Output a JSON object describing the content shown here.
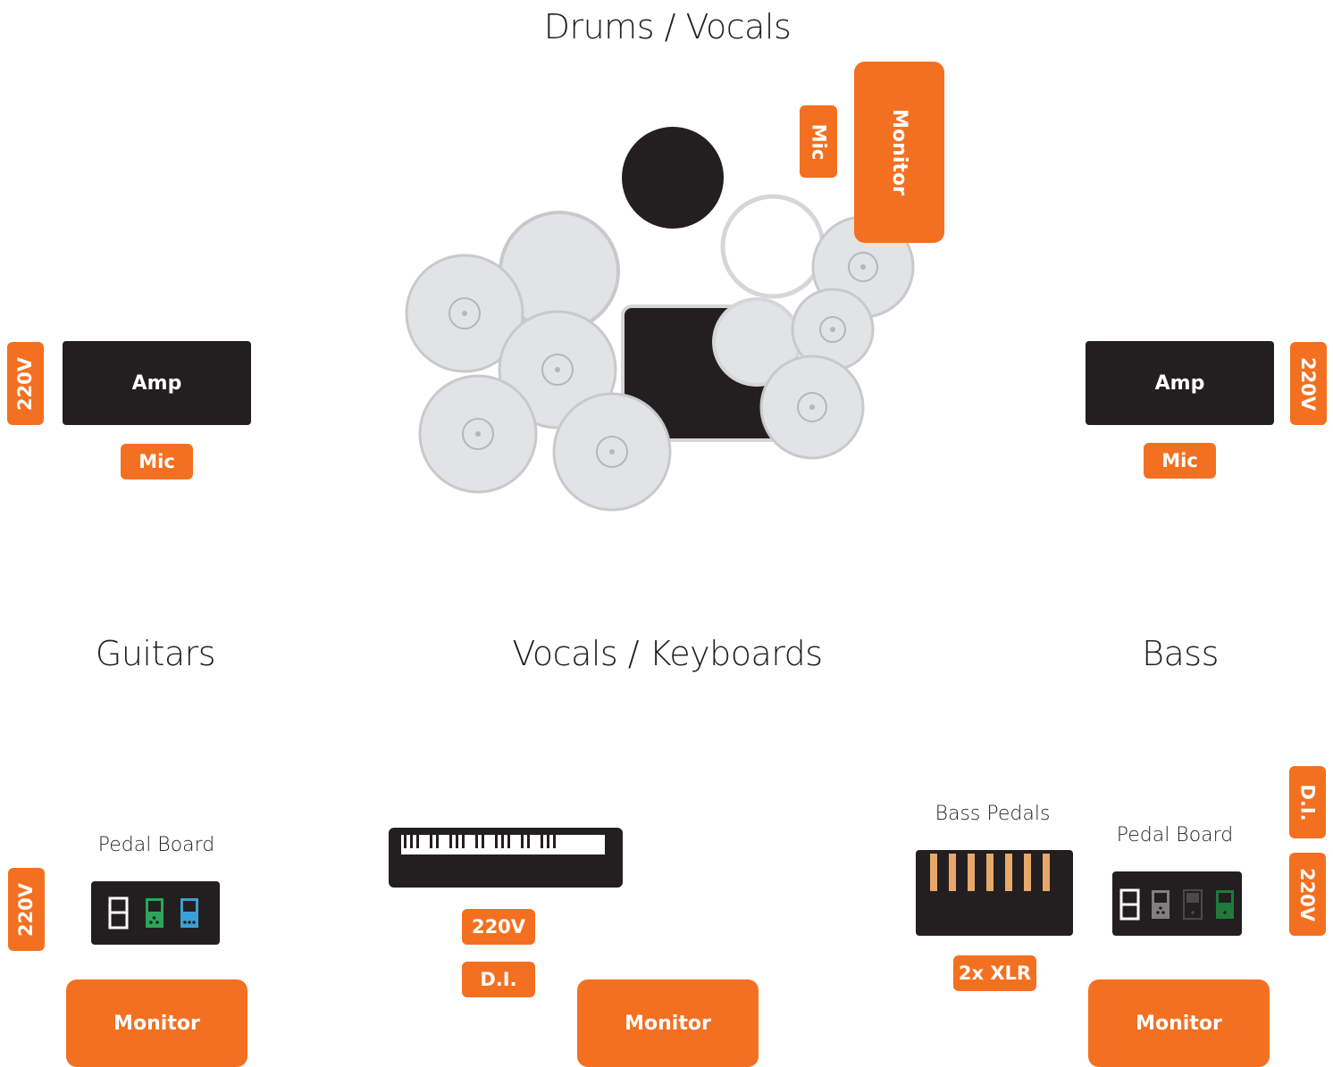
{
  "sections": {
    "drums_vocals": "Drums / Vocals",
    "guitars": "Guitars",
    "vocals_keyboards": "Vocals / Keyboards",
    "bass": "Bass"
  },
  "labels": {
    "monitor": "Monitor",
    "mic": "Mic",
    "amp": "Amp",
    "power": "220V",
    "di": "D.I.",
    "xlr": "2x XLR",
    "pedal_board": "Pedal Board",
    "bass_pedals": "Bass Pedals"
  },
  "colors": {
    "accent": "#f37021",
    "equipment": "#231f20",
    "cymbal": "#e2e3e5",
    "cymbal_edge": "#c8c9cb",
    "pedal_green": "#2ea55c",
    "pedal_blue": "#3d9fd8",
    "pedal_grey": "#808080",
    "pedal_darkgreen": "#1f7a3a",
    "bass_pedal_key": "#e8a86a"
  }
}
